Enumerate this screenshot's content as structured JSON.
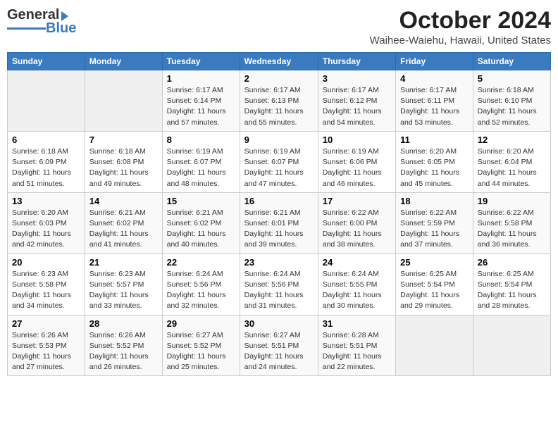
{
  "header": {
    "logo_general": "General",
    "logo_blue": "Blue",
    "title": "October 2024",
    "subtitle": "Waihee-Waiehu, Hawaii, United States"
  },
  "columns": [
    "Sunday",
    "Monday",
    "Tuesday",
    "Wednesday",
    "Thursday",
    "Friday",
    "Saturday"
  ],
  "weeks": [
    [
      {
        "day": "",
        "info": ""
      },
      {
        "day": "",
        "info": ""
      },
      {
        "day": "1",
        "info": "Sunrise: 6:17 AM\nSunset: 6:14 PM\nDaylight: 11 hours and 57 minutes."
      },
      {
        "day": "2",
        "info": "Sunrise: 6:17 AM\nSunset: 6:13 PM\nDaylight: 11 hours and 55 minutes."
      },
      {
        "day": "3",
        "info": "Sunrise: 6:17 AM\nSunset: 6:12 PM\nDaylight: 11 hours and 54 minutes."
      },
      {
        "day": "4",
        "info": "Sunrise: 6:17 AM\nSunset: 6:11 PM\nDaylight: 11 hours and 53 minutes."
      },
      {
        "day": "5",
        "info": "Sunrise: 6:18 AM\nSunset: 6:10 PM\nDaylight: 11 hours and 52 minutes."
      }
    ],
    [
      {
        "day": "6",
        "info": "Sunrise: 6:18 AM\nSunset: 6:09 PM\nDaylight: 11 hours and 51 minutes."
      },
      {
        "day": "7",
        "info": "Sunrise: 6:18 AM\nSunset: 6:08 PM\nDaylight: 11 hours and 49 minutes."
      },
      {
        "day": "8",
        "info": "Sunrise: 6:19 AM\nSunset: 6:07 PM\nDaylight: 11 hours and 48 minutes."
      },
      {
        "day": "9",
        "info": "Sunrise: 6:19 AM\nSunset: 6:07 PM\nDaylight: 11 hours and 47 minutes."
      },
      {
        "day": "10",
        "info": "Sunrise: 6:19 AM\nSunset: 6:06 PM\nDaylight: 11 hours and 46 minutes."
      },
      {
        "day": "11",
        "info": "Sunrise: 6:20 AM\nSunset: 6:05 PM\nDaylight: 11 hours and 45 minutes."
      },
      {
        "day": "12",
        "info": "Sunrise: 6:20 AM\nSunset: 6:04 PM\nDaylight: 11 hours and 44 minutes."
      }
    ],
    [
      {
        "day": "13",
        "info": "Sunrise: 6:20 AM\nSunset: 6:03 PM\nDaylight: 11 hours and 42 minutes."
      },
      {
        "day": "14",
        "info": "Sunrise: 6:21 AM\nSunset: 6:02 PM\nDaylight: 11 hours and 41 minutes."
      },
      {
        "day": "15",
        "info": "Sunrise: 6:21 AM\nSunset: 6:02 PM\nDaylight: 11 hours and 40 minutes."
      },
      {
        "day": "16",
        "info": "Sunrise: 6:21 AM\nSunset: 6:01 PM\nDaylight: 11 hours and 39 minutes."
      },
      {
        "day": "17",
        "info": "Sunrise: 6:22 AM\nSunset: 6:00 PM\nDaylight: 11 hours and 38 minutes."
      },
      {
        "day": "18",
        "info": "Sunrise: 6:22 AM\nSunset: 5:59 PM\nDaylight: 11 hours and 37 minutes."
      },
      {
        "day": "19",
        "info": "Sunrise: 6:22 AM\nSunset: 5:58 PM\nDaylight: 11 hours and 36 minutes."
      }
    ],
    [
      {
        "day": "20",
        "info": "Sunrise: 6:23 AM\nSunset: 5:58 PM\nDaylight: 11 hours and 34 minutes."
      },
      {
        "day": "21",
        "info": "Sunrise: 6:23 AM\nSunset: 5:57 PM\nDaylight: 11 hours and 33 minutes."
      },
      {
        "day": "22",
        "info": "Sunrise: 6:24 AM\nSunset: 5:56 PM\nDaylight: 11 hours and 32 minutes."
      },
      {
        "day": "23",
        "info": "Sunrise: 6:24 AM\nSunset: 5:56 PM\nDaylight: 11 hours and 31 minutes."
      },
      {
        "day": "24",
        "info": "Sunrise: 6:24 AM\nSunset: 5:55 PM\nDaylight: 11 hours and 30 minutes."
      },
      {
        "day": "25",
        "info": "Sunrise: 6:25 AM\nSunset: 5:54 PM\nDaylight: 11 hours and 29 minutes."
      },
      {
        "day": "26",
        "info": "Sunrise: 6:25 AM\nSunset: 5:54 PM\nDaylight: 11 hours and 28 minutes."
      }
    ],
    [
      {
        "day": "27",
        "info": "Sunrise: 6:26 AM\nSunset: 5:53 PM\nDaylight: 11 hours and 27 minutes."
      },
      {
        "day": "28",
        "info": "Sunrise: 6:26 AM\nSunset: 5:52 PM\nDaylight: 11 hours and 26 minutes."
      },
      {
        "day": "29",
        "info": "Sunrise: 6:27 AM\nSunset: 5:52 PM\nDaylight: 11 hours and 25 minutes."
      },
      {
        "day": "30",
        "info": "Sunrise: 6:27 AM\nSunset: 5:51 PM\nDaylight: 11 hours and 24 minutes."
      },
      {
        "day": "31",
        "info": "Sunrise: 6:28 AM\nSunset: 5:51 PM\nDaylight: 11 hours and 22 minutes."
      },
      {
        "day": "",
        "info": ""
      },
      {
        "day": "",
        "info": ""
      }
    ]
  ]
}
